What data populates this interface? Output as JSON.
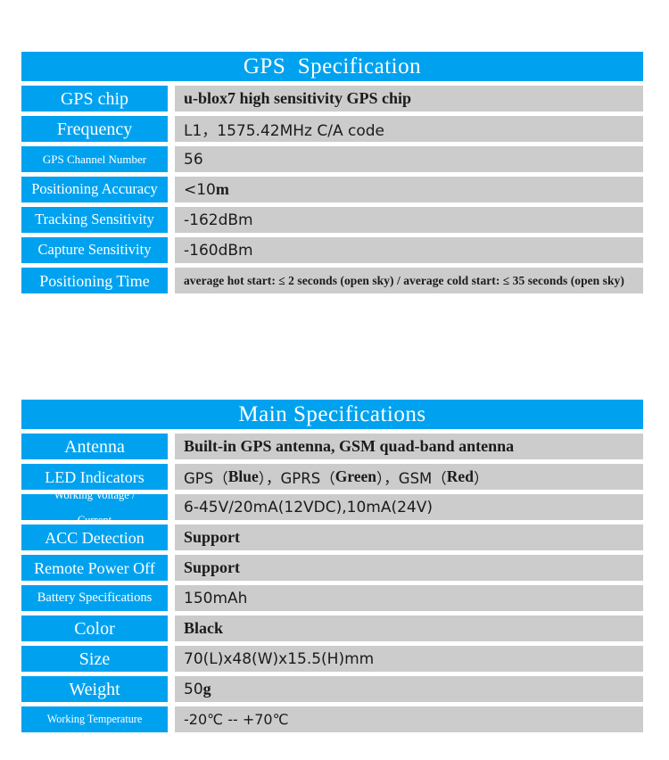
{
  "tables": [
    {
      "title": "GPS  Specification",
      "rows": [
        {
          "label": "GPS chip",
          "value": "u-blox7 high sensitivity GPS chip"
        },
        {
          "label": "Frequency",
          "value": "L1，1575.42MHz C/A code"
        },
        {
          "label": "GPS Channel Number",
          "value": "56"
        },
        {
          "label": "Positioning Accuracy",
          "value_num": "<10 ",
          "value_unit": "m"
        },
        {
          "label": "Tracking Sensitivity",
          "value": "-162dBm"
        },
        {
          "label": "Capture Sensitivity",
          "value": "-160dBm"
        },
        {
          "label": "Positioning Time",
          "value": "average hot start: ≤ 2 seconds (open sky) / average cold start: ≤ 35 seconds (open sky)"
        }
      ]
    },
    {
      "title": "Main Specifications",
      "rows": [
        {
          "label": "Antenna",
          "value": "Built-in GPS antenna, GSM quad-band antenna"
        },
        {
          "label_line1": "Working Voltage /",
          "label_line2": "Current",
          "value": "6-45V/20mA(12VDC),10mA(24V)"
        },
        {
          "label": "ACC Detection",
          "value": "Support"
        },
        {
          "label": "Remote Power Off",
          "value": "Support"
        },
        {
          "label": "Battery Specifications",
          "value": "150mAh"
        },
        {
          "label": "Color",
          "value": "Black"
        },
        {
          "label": "Size",
          "value": "70(L)x48(W)x15.5(H)mm"
        },
        {
          "label": "Weight",
          "value_num": "50 ",
          "value_unit": "g"
        },
        {
          "label": "Working Temperature",
          "value": "-20℃ -- +70℃"
        }
      ],
      "led_row": {
        "label": "LED Indicators",
        "seg1": "GPS（",
        "seg2": "Blue",
        "seg3": "），GPRS（",
        "seg4": "Green",
        "seg5": "），GSM（",
        "seg6": "Red",
        "seg7": "）"
      }
    }
  ],
  "colors": {
    "accent_blue": "#00A2F0",
    "value_gray": "#CBCCCB",
    "title_text": "#FFFFFF",
    "value_text": "#1B1B1B",
    "page_background": "#FFFFFF"
  }
}
